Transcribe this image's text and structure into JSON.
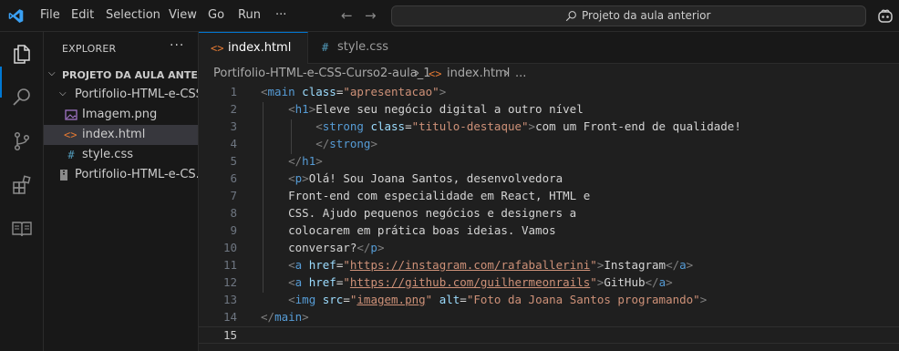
{
  "menu": [
    "File",
    "Edit",
    "Selection",
    "View",
    "Go",
    "Run",
    "···"
  ],
  "search": {
    "text": "Projeto da aula anterior"
  },
  "explorer": {
    "header": "EXPLORER",
    "more": "···",
    "root": "PROJETO DA AULA ANTER...",
    "folder": "Portifolio-HTML-e-CSS...",
    "files": [
      "Imagem.png",
      "index.html",
      "style.css"
    ],
    "zip": "Portifolio-HTML-e-CS..."
  },
  "tabs": [
    {
      "label": "index.html",
      "icon": "<>"
    },
    {
      "label": "style.css",
      "icon": "#"
    }
  ],
  "breadcrumb": [
    "Portifolio-HTML-e-CSS-Curso2-aula_1",
    "›",
    "<>",
    "index.html",
    "›",
    "..."
  ],
  "editor": {
    "line_numbers": [
      "1",
      "2",
      "3",
      "4",
      "5",
      "6",
      "7",
      "8",
      "9",
      "10",
      "11",
      "12",
      "13",
      "14",
      "15"
    ],
    "lines": [
      [
        [
          "t",
          "<"
        ],
        [
          "tg",
          "main"
        ],
        [
          "tx",
          " "
        ],
        [
          "at",
          "class"
        ],
        [
          "tx",
          "="
        ],
        [
          "st",
          "\"apresentacao\""
        ],
        [
          "t",
          ">"
        ]
      ],
      [
        [
          "tx",
          "    "
        ],
        [
          "t",
          "<"
        ],
        [
          "tg",
          "h1"
        ],
        [
          "t",
          ">"
        ],
        [
          "tx",
          "Eleve seu negócio digital a outro nível"
        ]
      ],
      [
        [
          "tx",
          "        "
        ],
        [
          "t",
          "<"
        ],
        [
          "tg",
          "strong"
        ],
        [
          "tx",
          " "
        ],
        [
          "at",
          "class"
        ],
        [
          "tx",
          "="
        ],
        [
          "st",
          "\"titulo-destaque\""
        ],
        [
          "t",
          ">"
        ],
        [
          "tx",
          "com um Front-end de qualidade!"
        ]
      ],
      [
        [
          "tx",
          "        "
        ],
        [
          "t",
          "</"
        ],
        [
          "tg",
          "strong"
        ],
        [
          "t",
          ">"
        ]
      ],
      [
        [
          "tx",
          "    "
        ],
        [
          "t",
          "</"
        ],
        [
          "tg",
          "h1"
        ],
        [
          "t",
          ">"
        ]
      ],
      [
        [
          "tx",
          "    "
        ],
        [
          "t",
          "<"
        ],
        [
          "tg",
          "p"
        ],
        [
          "t",
          ">"
        ],
        [
          "tx",
          "Olá! Sou Joana Santos, desenvolvedora"
        ]
      ],
      [
        [
          "tx",
          "    Front-end com especialidade em React, HTML e"
        ]
      ],
      [
        [
          "tx",
          "    CSS. Ajudo pequenos negócios e designers a"
        ]
      ],
      [
        [
          "tx",
          "    colocarem em prática boas ideias. Vamos"
        ]
      ],
      [
        [
          "tx",
          "    conversar?"
        ],
        [
          "t",
          "</"
        ],
        [
          "tg",
          "p"
        ],
        [
          "t",
          ">"
        ]
      ],
      [
        [
          "tx",
          "    "
        ],
        [
          "t",
          "<"
        ],
        [
          "tg",
          "a"
        ],
        [
          "tx",
          " "
        ],
        [
          "at",
          "href"
        ],
        [
          "tx",
          "="
        ],
        [
          "st",
          "\""
        ],
        [
          "stu",
          "https://instagram.com/rafaballerini"
        ],
        [
          "st",
          "\""
        ],
        [
          "t",
          ">"
        ],
        [
          "tx",
          "Instagram"
        ],
        [
          "t",
          "</"
        ],
        [
          "tg",
          "a"
        ],
        [
          "t",
          ">"
        ]
      ],
      [
        [
          "tx",
          "    "
        ],
        [
          "t",
          "<"
        ],
        [
          "tg",
          "a"
        ],
        [
          "tx",
          " "
        ],
        [
          "at",
          "href"
        ],
        [
          "tx",
          "="
        ],
        [
          "st",
          "\""
        ],
        [
          "stu",
          "https://github.com/guilhermeonrails"
        ],
        [
          "st",
          "\""
        ],
        [
          "t",
          ">"
        ],
        [
          "tx",
          "GitHub"
        ],
        [
          "t",
          "</"
        ],
        [
          "tg",
          "a"
        ],
        [
          "t",
          ">"
        ]
      ],
      [
        [
          "tx",
          "    "
        ],
        [
          "t",
          "<"
        ],
        [
          "tg",
          "img"
        ],
        [
          "tx",
          " "
        ],
        [
          "at",
          "src"
        ],
        [
          "tx",
          "="
        ],
        [
          "st",
          "\""
        ],
        [
          "stu",
          "imagem.png"
        ],
        [
          "st",
          "\""
        ],
        [
          "tx",
          " "
        ],
        [
          "at",
          "alt"
        ],
        [
          "tx",
          "="
        ],
        [
          "st",
          "\"Foto da Joana Santos programando\""
        ],
        [
          "t",
          ">"
        ]
      ],
      [
        [
          "t",
          "</"
        ],
        [
          "tg",
          "main"
        ],
        [
          "t",
          ">"
        ]
      ],
      []
    ]
  },
  "colors": {
    "accent": "#0078d4",
    "html_icon": "#e37933",
    "css_icon": "#519aba",
    "tag": "#569cd6",
    "attribute": "#9cdcfe",
    "string": "#ce9178"
  }
}
